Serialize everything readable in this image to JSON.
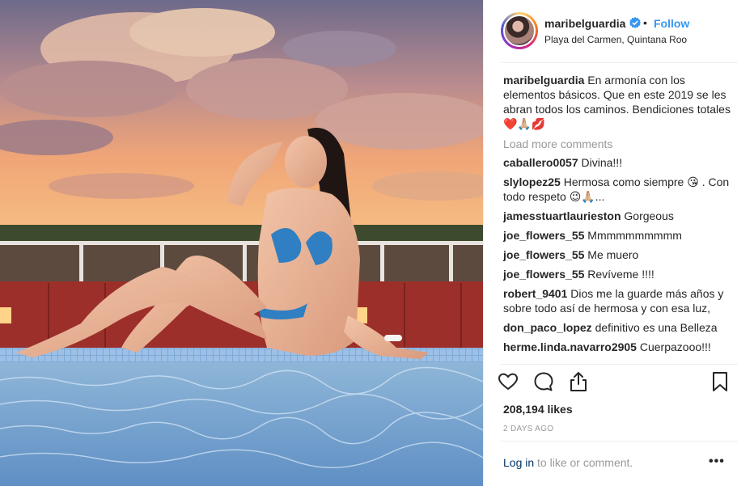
{
  "post": {
    "username": "maribelguardia",
    "location": "Playa del Carmen, Quintana Roo",
    "follow_label": "Follow",
    "dot": "•",
    "caption": {
      "username": "maribelguardia",
      "text": "En armonía con los elementos básicos. Que en este 2019 se les abran todos los caminos. Bendiciones totales",
      "emojis": "❤️🙏🏼💋"
    },
    "load_more_label": "Load more comments",
    "comments": [
      {
        "user": "caballero0057",
        "text": "Divina!!!"
      },
      {
        "user": "slylopez25",
        "text": "Hermosa como siempre 😘 . Con todo respeto 😉🙏🏼..."
      },
      {
        "user": "jamesstuartlaurieston",
        "text": "Gorgeous"
      },
      {
        "user": "joe_flowers_55",
        "text": "Mmmmmmmmmm"
      },
      {
        "user": "joe_flowers_55",
        "text": "Me muero"
      },
      {
        "user": "joe_flowers_55",
        "text": "Revíveme !!!!"
      },
      {
        "user": "robert_9401",
        "text": "Dios me la guarde más años y sobre todo así de hermosa y con esa luz,"
      },
      {
        "user": "don_paco_lopez",
        "text": "definitivo es una Belleza"
      },
      {
        "user": "herme.linda.navarro2905",
        "text": "Cuerpazooo!!!"
      }
    ],
    "likes": "208,194 likes",
    "timestamp": "2 DAYS AGO",
    "login_link": "Log in",
    "login_suffix": " to like or comment.",
    "more_label": "•••"
  },
  "icons": {
    "like": "heart-outline-icon",
    "comment": "speech-bubble-icon",
    "share": "share-upload-icon",
    "save": "bookmark-icon",
    "verified": "verified-badge-icon"
  },
  "colors": {
    "follow": "#3897f0",
    "login_link": "#003569",
    "muted": "#999999",
    "verified": "#3897f0"
  }
}
